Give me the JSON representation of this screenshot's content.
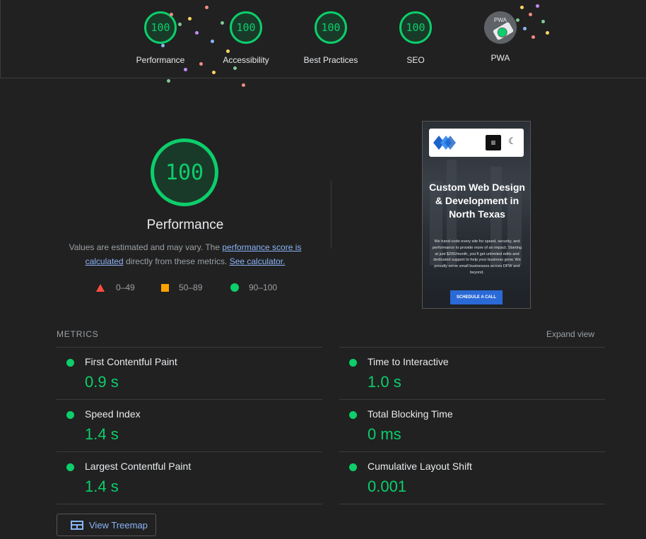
{
  "categories": [
    {
      "score": "100",
      "label": "Performance"
    },
    {
      "score": "100",
      "label": "Accessibility"
    },
    {
      "score": "100",
      "label": "Best Practices"
    },
    {
      "score": "100",
      "label": "SEO"
    }
  ],
  "pwa": {
    "text": "PWA",
    "label": "PWA"
  },
  "performance": {
    "score": "100",
    "title": "Performance",
    "estimate_prefix": "Values are estimated and may vary. The ",
    "score_link": "performance score is calculated",
    "estimate_middle": " directly from these metrics. ",
    "calculator_link": "See calculator."
  },
  "legend": [
    {
      "range": "0–49",
      "color": "#ff4e42"
    },
    {
      "range": "50–89",
      "color": "#ffa400"
    },
    {
      "range": "90–100",
      "color": "#0cce6b"
    }
  ],
  "screenshot": {
    "heading": "Custom Web Design & Development in North Texas",
    "body": "We hand-code every site for speed, security, and performance to provide more of an impact. Starting at just $200/month, you'll get unlimited edits and dedicated support to help your business grow. We proudly serve small businesses across DFW and beyond.",
    "button": "SCHEDULE A CALL",
    "menu_icon": "≡",
    "moon_icon": "☾"
  },
  "metrics": {
    "title": "METRICS",
    "expand": "Expand view",
    "items": [
      {
        "name": "First Contentful Paint",
        "value": "0.9 s"
      },
      {
        "name": "Time to Interactive",
        "value": "1.0 s"
      },
      {
        "name": "Speed Index",
        "value": "1.4 s"
      },
      {
        "name": "Total Blocking Time",
        "value": "0 ms"
      },
      {
        "name": "Largest Contentful Paint",
        "value": "1.4 s"
      },
      {
        "name": "Cumulative Layout Shift",
        "value": "0.001"
      }
    ]
  },
  "treemap": {
    "label": "View Treemap"
  },
  "colors": {
    "pass": "#0cce6b",
    "average": "#ffa400",
    "fail": "#ff4e42",
    "link": "#8ab4f8",
    "background": "#212121"
  }
}
